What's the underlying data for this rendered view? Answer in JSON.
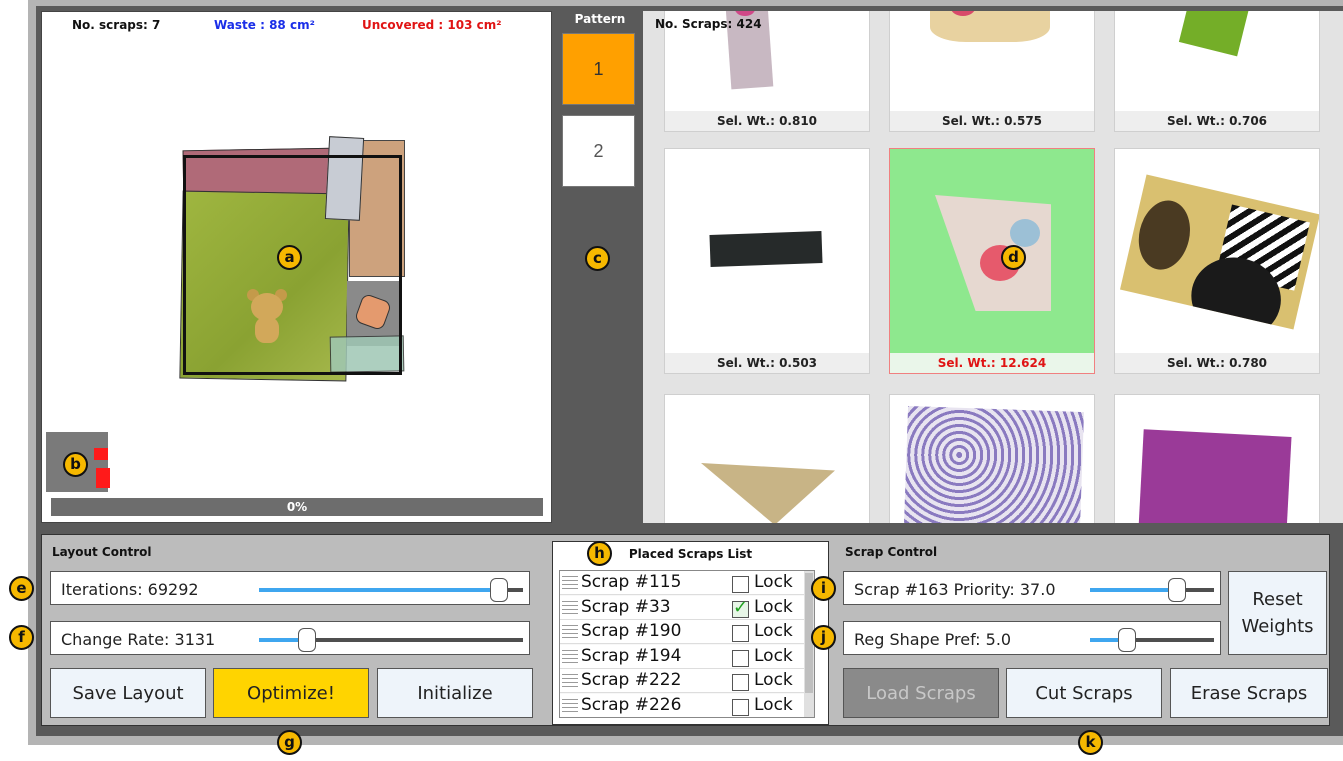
{
  "canvas": {
    "num_scraps": "No. scraps: 7",
    "waste": "Waste : 88 cm²",
    "uncovered": "Uncovered : 103 cm²",
    "progress_value": 0,
    "progress_text": "0%"
  },
  "pattern": {
    "title": "Pattern",
    "buttons": [
      {
        "label": "1",
        "active": true
      },
      {
        "label": "2",
        "active": false
      }
    ]
  },
  "gallery": {
    "count": "No. Scraps: 424",
    "cards": [
      {
        "label": "Sel. Wt.: 0.810"
      },
      {
        "label": "Sel. Wt.: 0.575"
      },
      {
        "label": "Sel. Wt.: 0.706"
      },
      {
        "label": "Sel. Wt.: 0.503"
      },
      {
        "label": "Sel. Wt.: 12.624",
        "highlight": true
      },
      {
        "label": "Sel. Wt.: 0.780"
      }
    ]
  },
  "layout_control": {
    "title": "Layout Control",
    "iterations": {
      "label": "Iterations: 69292",
      "level": 0.91
    },
    "change_rate": {
      "label": "Change Rate: 3131",
      "level": 0.18
    },
    "save_label": "Save Layout",
    "optimize_label": "Optimize!",
    "initialize_label": "Initialize"
  },
  "placed_list": {
    "title": "Placed Scraps List",
    "items": [
      {
        "label": "Scrap #115",
        "lock": "Lock",
        "locked": false
      },
      {
        "label": "Scrap #33",
        "lock": "Lock",
        "locked": true
      },
      {
        "label": "Scrap #190",
        "lock": "Lock",
        "locked": false
      },
      {
        "label": "Scrap #194",
        "lock": "Lock",
        "locked": false
      },
      {
        "label": "Scrap #222",
        "lock": "Lock",
        "locked": false
      },
      {
        "label": "Scrap #226",
        "lock": "Lock",
        "locked": false
      }
    ]
  },
  "scrap_control": {
    "title": "Scrap Control",
    "priority": {
      "label": "Scrap #163 Priority: 37.0",
      "level": 0.7
    },
    "shape_pref": {
      "label": "Reg Shape Pref: 5.0",
      "level": 0.3
    },
    "reset_label": "Reset Weights",
    "load_label": "Load Scraps",
    "cut_label": "Cut Scraps",
    "erase_label": "Erase Scraps"
  },
  "markers": [
    "a",
    "b",
    "c",
    "d",
    "e",
    "f",
    "g",
    "h",
    "i",
    "j",
    "k"
  ],
  "colors": {
    "accent_orange": "#ffa000",
    "optimize_yellow": "#ffd400",
    "slider_blue": "#3fa6ef",
    "selection_green": "#8ee88e",
    "waste_blue": "#1a2ee8",
    "uncovered_red": "#e01414"
  }
}
